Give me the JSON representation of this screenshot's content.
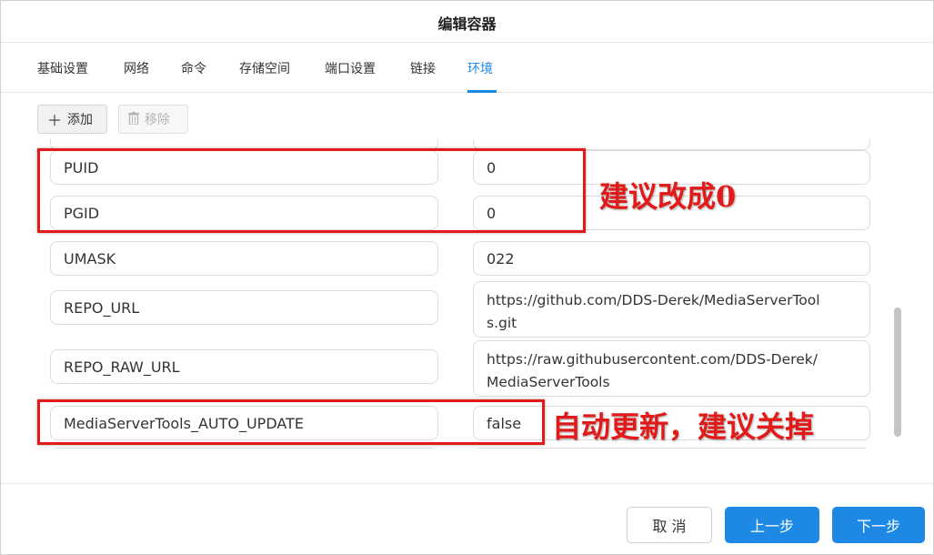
{
  "dialog": {
    "title": "编辑容器"
  },
  "tabs": [
    {
      "label": "基础设置"
    },
    {
      "label": "网络"
    },
    {
      "label": "命令"
    },
    {
      "label": "存储空间"
    },
    {
      "label": "端口设置"
    },
    {
      "label": "链接"
    },
    {
      "label": "环境",
      "active": true
    }
  ],
  "toolbar": {
    "add_icon": "plus-icon",
    "add_label": "添加",
    "remove_icon": "trash-icon",
    "remove_label": "移除"
  },
  "env_vars": [
    {
      "key": "",
      "value": ""
    },
    {
      "key": "PUID",
      "value": "0"
    },
    {
      "key": "PGID",
      "value": "0"
    },
    {
      "key": "UMASK",
      "value": "022"
    },
    {
      "key": "REPO_URL",
      "value": "https://github.com/DDS-Derek/MediaServerTool\ns.git"
    },
    {
      "key": "REPO_RAW_URL",
      "value": "https://raw.githubusercontent.com/DDS-Derek/\nMediaServerTools"
    },
    {
      "key": "MediaServerTools_AUTO_UPDATE",
      "value": "false"
    },
    {
      "key": "",
      "value": ""
    }
  ],
  "annotations": {
    "note1": "建议改成0",
    "note2": "自动更新，建议关掉",
    "color": "#e21a1a"
  },
  "footer": {
    "cancel_label": "取 消",
    "prev_label": "上一步",
    "next_label": "下一步"
  },
  "colors": {
    "accent": "#1e88e5"
  }
}
